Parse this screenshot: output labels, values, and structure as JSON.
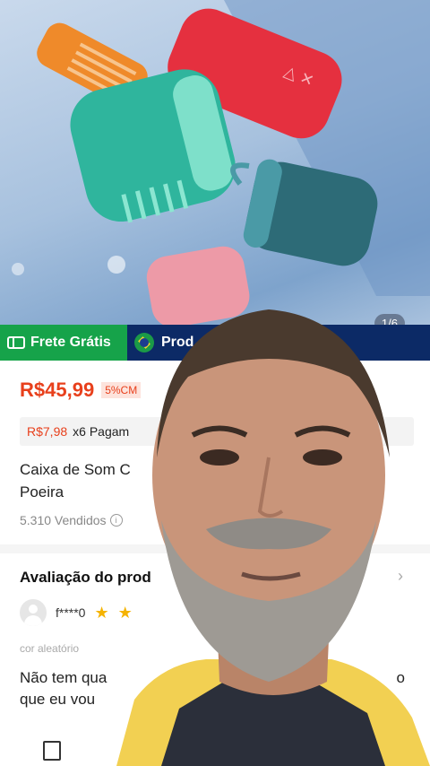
{
  "gallery": {
    "counter": "1/6"
  },
  "badges": {
    "free_shipping": "Frete Grátis",
    "product_origin": "Prod"
  },
  "price": {
    "current": "R$45,99",
    "discount": "5%CM"
  },
  "installment": {
    "amount": "R$7,98",
    "text": "x6 Pagam"
  },
  "product": {
    "title_line1": "Caixa de Som C",
    "title_line2": "Poeira",
    "sold": "5.310 Vendidos"
  },
  "reviews": {
    "heading": "Avaliação do prod",
    "reviewer": "f****0",
    "variant": "cor aleatório",
    "text_line1": "Não tem qua",
    "text_line1_right": "o",
    "text_line2": "que eu vou"
  }
}
